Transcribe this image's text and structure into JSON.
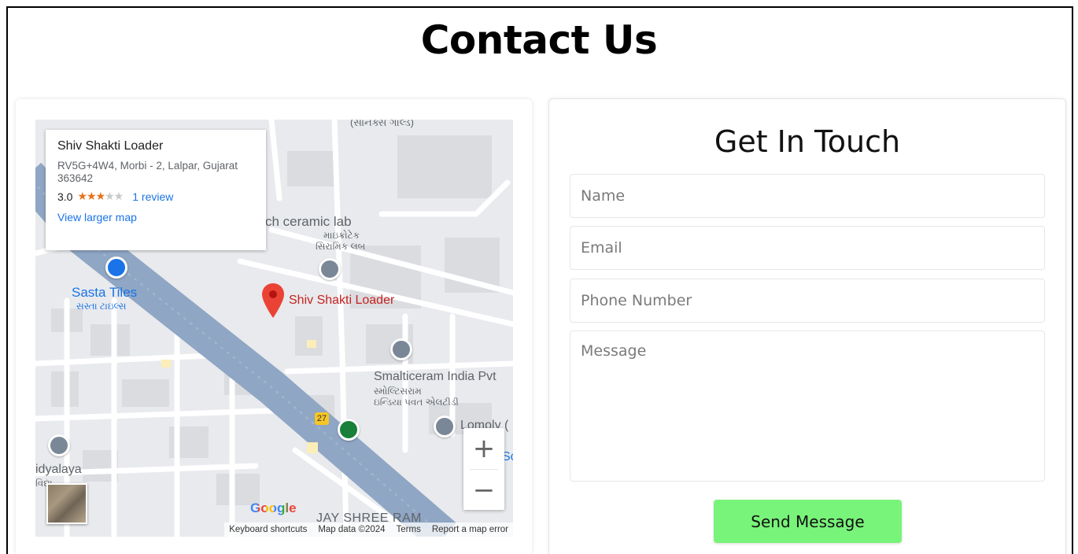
{
  "page": {
    "title_highlight": "Contact",
    "title_rest": " Us"
  },
  "map": {
    "info_card": {
      "name": "Shiv Shakti Loader",
      "address": "RV5G+4W4, Morbi - 2, Lalpar, Gujarat 363642",
      "rating": "3.0",
      "stars_filled": "★★★",
      "stars_empty": "★★",
      "review_link": "1 review",
      "larger_map_link": "View larger map"
    },
    "labels": {
      "top_road": "(સાનક્સ ગાલ્ડ)",
      "ceramic_lab": "ch ceramic lab",
      "ceramic_lab_gu1": "માઇક્રોટેક",
      "ceramic_lab_gu2": "સિરામિક લબ",
      "sasta_tiles": "Sasta Tiles",
      "sasta_tiles_gu": "સસ્તા ટાઇલ્સ",
      "pin_label": "Shiv Shakti Loader",
      "smalticeram": "Smalticeram India Pvt",
      "smalticeram_gu1": "સ્મોલ્ટિસરામ",
      "smalticeram_gu2": "ઇન્ડિયા પવત એલટીડી",
      "lomoly": "Lomoly (",
      "sc_partial": "Sc",
      "vidyalaya": "idyalaya",
      "vidyalaya_gu": "વિદ્યા",
      "road_badge": "27",
      "jay_shree": "JAY SHREE RAM"
    },
    "google_logo": "Google",
    "footer": {
      "keyboard": "Keyboard shortcuts",
      "map_data": "Map data ©2024",
      "terms": "Terms",
      "report": "Report a map error"
    },
    "zoom_in": "+",
    "zoom_out": "−"
  },
  "form": {
    "title": "Get In Touch",
    "name_placeholder": "Name",
    "email_placeholder": "Email",
    "phone_placeholder": "Phone Number",
    "message_placeholder": "Message",
    "submit_label": "Send Message"
  },
  "colors": {
    "title_underline": "#5cef3a",
    "button": "#79f47a",
    "pin": "#ea4335",
    "link": "#1a73e8"
  }
}
